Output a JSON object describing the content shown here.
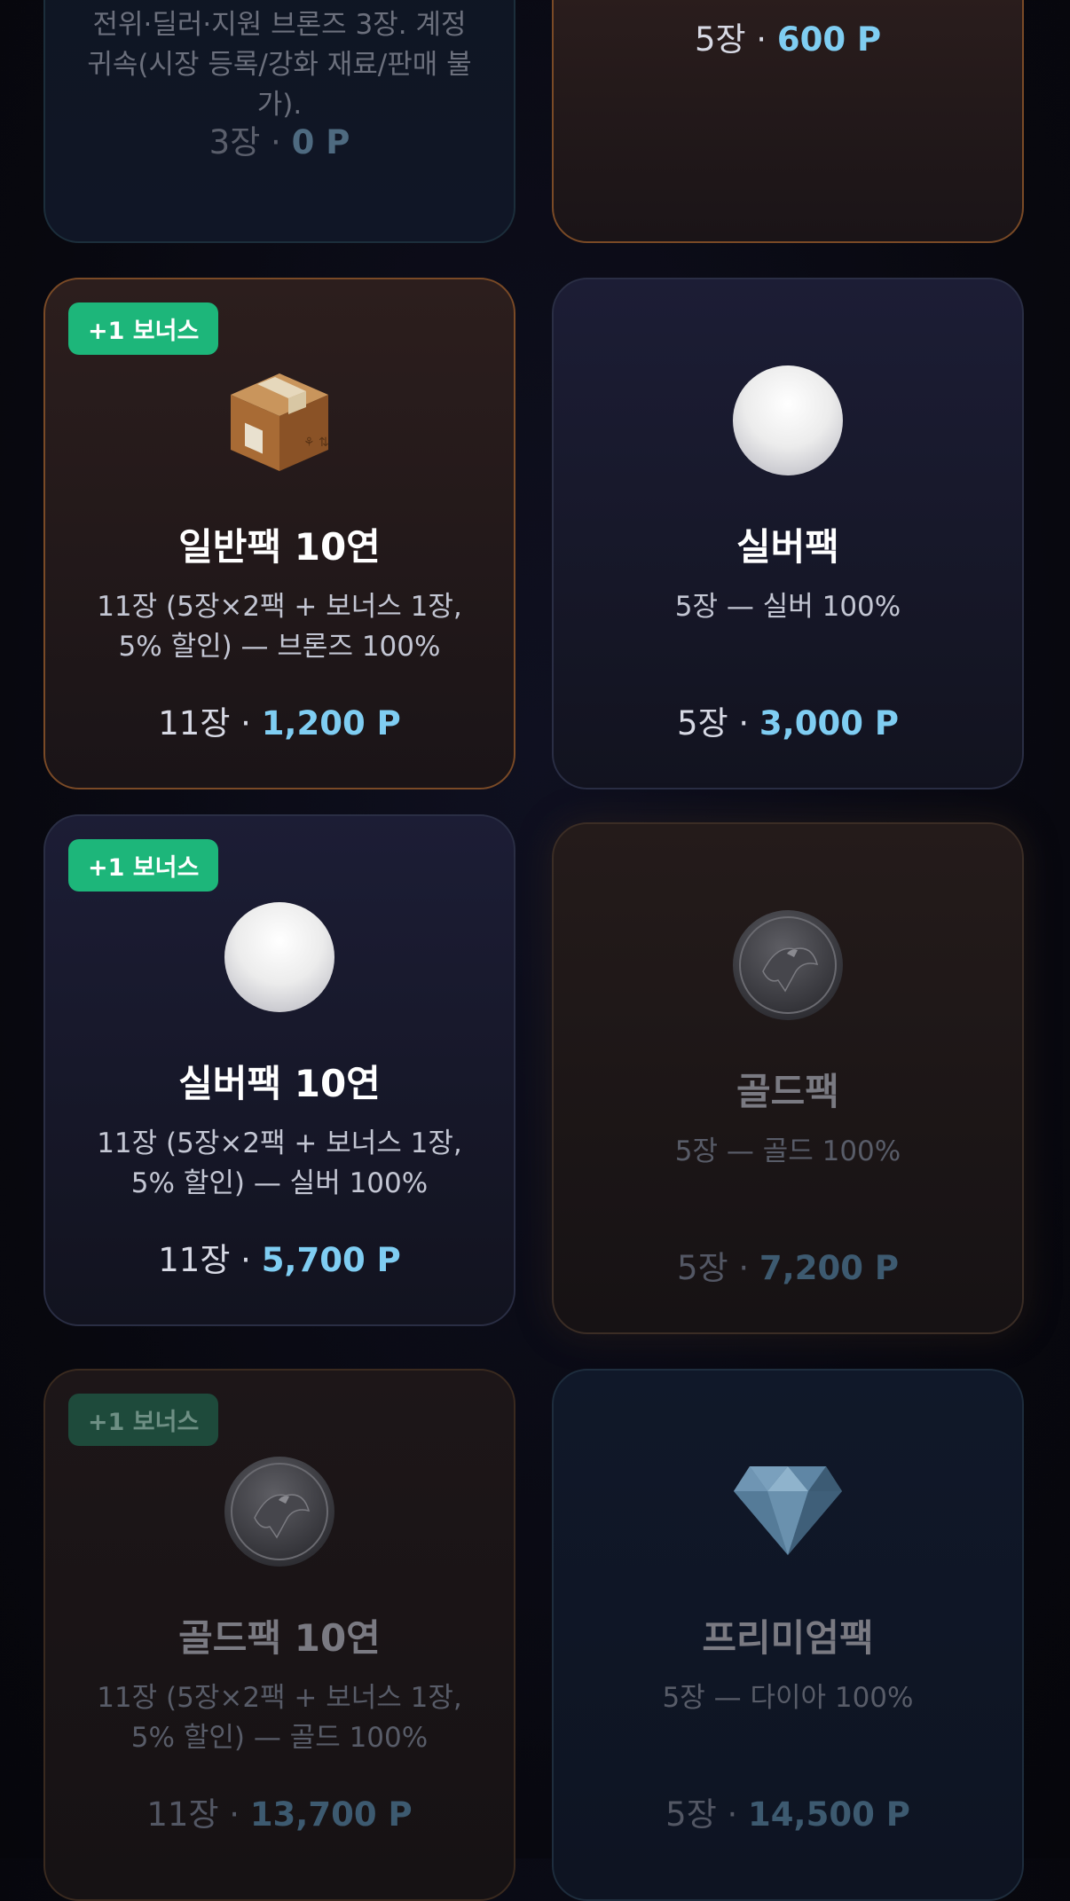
{
  "cards": [
    {
      "desc": "전위·딜러·지원 브론즈 3장. 계정 귀속(시장 등록/강화 재료/판매 불가).",
      "count": "3장",
      "sep": " · ",
      "price": "0 P"
    },
    {
      "count": "5장",
      "sep": " · ",
      "price": "600 P"
    },
    {
      "badge": "+1 보너스",
      "icon": "box-icon",
      "title": "일반팩 10연",
      "desc": "11장 (5장×2팩 + 보너스 1장, 5% 할인) — 브론즈 100%",
      "count": "11장",
      "sep": " · ",
      "price": "1,200 P"
    },
    {
      "icon": "silver-circle-icon",
      "title": "실버팩",
      "desc": "5장 — 실버 100%",
      "count": "5장",
      "sep": " · ",
      "price": "3,000 P"
    },
    {
      "badge": "+1 보너스",
      "icon": "silver-circle-icon",
      "title": "실버팩 10연",
      "desc": "11장 (5장×2팩 + 보너스 1장, 5% 할인) — 실버 100%",
      "count": "11장",
      "sep": " · ",
      "price": "5,700 P"
    },
    {
      "icon": "coin-icon",
      "title": "골드팩",
      "desc": "5장 — 골드 100%",
      "count": "5장",
      "sep": " · ",
      "price": "7,200 P"
    },
    {
      "badge": "+1 보너스",
      "icon": "coin-icon",
      "title": "골드팩 10연",
      "desc": "11장 (5장×2팩 + 보너스 1장, 5% 할인) — 골드 100%",
      "count": "11장",
      "sep": " · ",
      "price": "13,700 P"
    },
    {
      "icon": "diamond-icon",
      "title": "프리미엄팩",
      "desc": "5장 — 다이아 100%",
      "count": "5장",
      "sep": " · ",
      "price": "14,500 P"
    }
  ]
}
